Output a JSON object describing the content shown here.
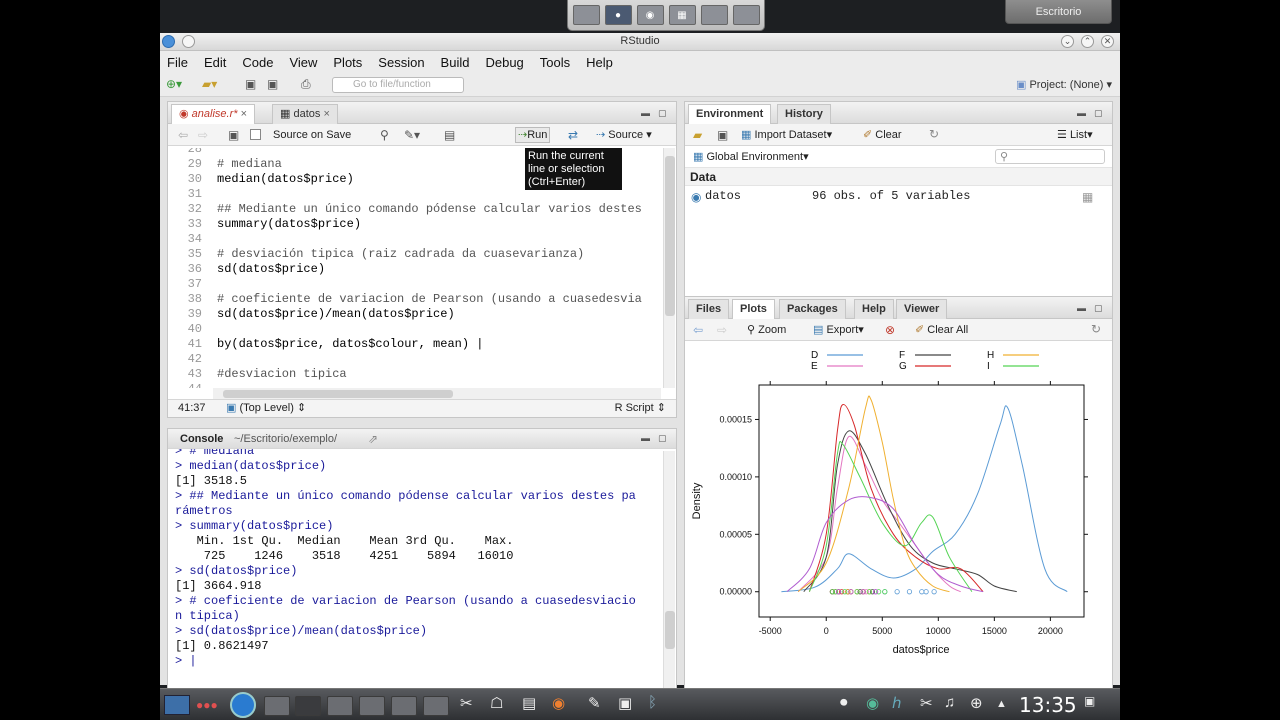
{
  "desktop": {
    "escritorio_label": "Escritorio",
    "clock": "13:35"
  },
  "window": {
    "title": "RStudio"
  },
  "menu": [
    "File",
    "Edit",
    "Code",
    "View",
    "Plots",
    "Session",
    "Build",
    "Debug",
    "Tools",
    "Help"
  ],
  "toolbar": {
    "goto_placeholder": "Go to file/function",
    "project": "Project: (None)"
  },
  "editor": {
    "tabs": [
      {
        "label": "analise.r*"
      },
      {
        "label": "datos"
      }
    ],
    "source_on_save": "Source on Save",
    "run_label": "Run",
    "source_label": "Source",
    "tooltip": [
      "Run the current",
      "line or selection",
      "(Ctrl+Enter)"
    ],
    "lines": [
      {
        "n": "28",
        "t": "",
        "cm": false
      },
      {
        "n": "29",
        "t": "# mediana",
        "cm": true
      },
      {
        "n": "30",
        "t": "median(datos$price)",
        "cm": false
      },
      {
        "n": "31",
        "t": "",
        "cm": false
      },
      {
        "n": "32",
        "t": "## Mediante un único comando pódense calcular varios destes",
        "cm": true
      },
      {
        "n": "33",
        "t": "summary(datos$price)",
        "cm": false
      },
      {
        "n": "34",
        "t": "",
        "cm": false
      },
      {
        "n": "35",
        "t": "# desviación tipica (raiz cadrada da cuasevarianza)",
        "cm": true
      },
      {
        "n": "36",
        "t": "sd(datos$price)",
        "cm": false
      },
      {
        "n": "37",
        "t": "",
        "cm": false
      },
      {
        "n": "38",
        "t": "# coeficiente de variacion de Pearson (usando a cuasedesvia",
        "cm": true
      },
      {
        "n": "39",
        "t": "sd(datos$price)/mean(datos$price)",
        "cm": false
      },
      {
        "n": "40",
        "t": "",
        "cm": false
      },
      {
        "n": "41",
        "t": "by(datos$price, datos$colour, mean) |",
        "cm": false
      },
      {
        "n": "42",
        "t": "",
        "cm": false
      },
      {
        "n": "43",
        "t": "#desviacion tipica",
        "cm": true
      },
      {
        "n": "44",
        "t": "",
        "cm": false
      }
    ],
    "position": "41:37",
    "scope": "(Top Level)",
    "filetype": "R Script"
  },
  "console": {
    "title": "Console",
    "path": "~/Escritorio/exemplo/",
    "lines": [
      {
        "t": "> # mediana",
        "out": false
      },
      {
        "t": "> median(datos$price)",
        "out": false
      },
      {
        "t": "[1] 3518.5",
        "out": true
      },
      {
        "t": "> ## Mediante un único comando pódense calcular varios destes pa",
        "out": false
      },
      {
        "t": "rámetros",
        "out": false
      },
      {
        "t": "> summary(datos$price)",
        "out": false
      },
      {
        "t": "   Min. 1st Qu.  Median    Mean 3rd Qu.    Max.",
        "out": true
      },
      {
        "t": "    725    1246    3518    4251    5894   16010",
        "out": true
      },
      {
        "t": "> sd(datos$price)",
        "out": false
      },
      {
        "t": "[1] 3664.918",
        "out": true
      },
      {
        "t": "> # coeficiente de variacion de Pearson (usando a cuasedesviacio",
        "out": false
      },
      {
        "t": "n tipica)",
        "out": false
      },
      {
        "t": "> sd(datos$price)/mean(datos$price)",
        "out": false
      },
      {
        "t": "[1] 0.8621497",
        "out": true
      },
      {
        "t": "> |",
        "out": false
      }
    ]
  },
  "environment": {
    "tabs": [
      "Environment",
      "History"
    ],
    "import_label": "Import Dataset",
    "clear_label": "Clear",
    "list_label": "List",
    "global_env": "Global Environment",
    "section": "Data",
    "rows": [
      {
        "name": "datos",
        "value": "96 obs. of 5 variables"
      }
    ]
  },
  "plots_pane": {
    "tabs": [
      "Files",
      "Plots",
      "Packages",
      "Help",
      "Viewer"
    ],
    "zoom_label": "Zoom",
    "export_label": "Export",
    "clear_all_label": "Clear All"
  },
  "chart_data": {
    "type": "line",
    "title": "",
    "xlabel": "datos$price",
    "ylabel": "Density",
    "xlim": [
      -6000,
      23000
    ],
    "ylim": [
      -2.2e-05,
      0.00018
    ],
    "xticks": [
      -5000,
      0,
      5000,
      10000,
      15000,
      20000
    ],
    "yticks": [
      "0.00000",
      "0.00005",
      "0.00010",
      "0.00015"
    ],
    "legend_position": "top",
    "series": [
      {
        "name": "D",
        "color": "#5b9bd5",
        "x": [
          -4000,
          -1000,
          1000,
          2000,
          4000,
          6000,
          8000,
          9500,
          11500,
          13500,
          15500,
          16200,
          17500,
          19500,
          21500
        ],
        "y": [
          0,
          4e-06,
          2e-05,
          3.3e-05,
          2e-05,
          1.2e-05,
          2e-05,
          3.5e-05,
          5e-05,
          8.5e-05,
          0.000145,
          0.00016,
          0.00011,
          2e-05,
          0
        ]
      },
      {
        "name": "E",
        "color": "#e377c2",
        "x": [
          -2500,
          0,
          1000,
          2000,
          3500,
          5000,
          6500,
          8000,
          9500,
          11000,
          12000
        ],
        "y": [
          0,
          3e-05,
          9e-05,
          0.000135,
          0.00011,
          8e-05,
          6e-05,
          4e-05,
          2e-05,
          5e-06,
          0
        ]
      },
      {
        "name": "F",
        "color": "#444444",
        "x": [
          -2000,
          0,
          1000,
          2000,
          3500,
          5500,
          7500,
          9500,
          11500,
          13500,
          15000,
          17000
        ],
        "y": [
          0,
          3e-05,
          0.00011,
          0.00014,
          0.00012,
          7.5e-05,
          4e-05,
          2.5e-05,
          2e-05,
          1.5e-05,
          5e-06,
          0
        ]
      },
      {
        "name": "G",
        "color": "#d62728",
        "x": [
          -1500,
          0,
          1000,
          1500,
          2500,
          4000,
          6000,
          8000,
          10000,
          12000,
          14000
        ],
        "y": [
          0,
          5e-05,
          0.00014,
          0.000163,
          0.000145,
          9e-05,
          5e-05,
          3e-05,
          2e-05,
          2e-05,
          0
        ]
      },
      {
        "name": "H",
        "color": "#f0b030",
        "x": [
          -2500,
          0,
          2000,
          3500,
          4000,
          5000,
          6000,
          7000,
          8000,
          9500,
          11000
        ],
        "y": [
          0,
          2.5e-05,
          9e-05,
          0.00016,
          0.000167,
          0.00013,
          8e-05,
          4e-05,
          2e-05,
          5e-06,
          0
        ]
      },
      {
        "name": "I",
        "color": "#54d454",
        "x": [
          -1500,
          0,
          1000,
          1500,
          3000,
          5000,
          7000,
          8500,
          9500,
          11000,
          13000
        ],
        "y": [
          0,
          4e-05,
          0.00012,
          0.000128,
          0.0001,
          6e-05,
          4e-05,
          6e-05,
          6.5e-05,
          3e-05,
          0
        ]
      },
      {
        "name": "",
        "color": "#b05cd0",
        "x": [
          -3500,
          -1500,
          0,
          2000,
          4000,
          6000,
          8000,
          10000,
          12000,
          14000
        ],
        "y": [
          0,
          2e-05,
          6e-05,
          8e-05,
          8.2e-05,
          7.2e-05,
          4e-05,
          1.5e-05,
          5e-06,
          0
        ]
      }
    ]
  }
}
